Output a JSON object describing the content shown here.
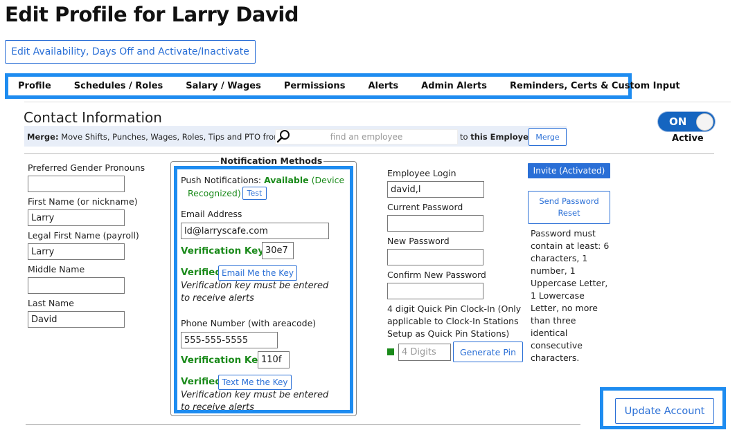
{
  "page": {
    "title": "Edit Profile for Larry David"
  },
  "availability_button": "Edit Availability, Days Off and Activate/Inactivate",
  "tabs": [
    "Profile",
    "Schedules / Roles",
    "Salary / Wages",
    "Permissions",
    "Alerts",
    "Admin Alerts",
    "Reminders, Certs & Custom Input"
  ],
  "contact": {
    "title": "Contact Information",
    "merge_bold": "Merge:",
    "merge_text": " Move Shifts, Punches, Wages, Roles, Tips and PTO from",
    "search_placeholder": "find an employee",
    "to_prefix": "to ",
    "to_bold": "this Employee",
    "merge_button": "Merge",
    "toggle_label": "ON",
    "status": "Active"
  },
  "fields": {
    "pronouns_label": "Preferred Gender Pronouns",
    "pronouns_value": "",
    "first_label": "First Name (or nickname)",
    "first_value": "Larry",
    "legal_label": "Legal First Name (payroll)",
    "legal_value": "Larry",
    "middle_label": "Middle Name",
    "middle_value": "",
    "last_label": "Last Name",
    "last_value": "David"
  },
  "notifications": {
    "legend": "Notification Methods",
    "push_label": "Push Notifications: ",
    "push_status": "Available",
    "push_detail_1": " (Device",
    "push_detail_2": "Recognized)",
    "test_button": "Test",
    "email_label": "Email Address",
    "email_value": "ld@larryscafe.com",
    "email_key_label": "Verification Key",
    "email_key_value": "30e7",
    "email_verified": "Verified",
    "email_key_button": "Email Me the Key",
    "email_note_1": "Verification key must be entered",
    "email_note_2": "to receive alerts",
    "phone_label": "Phone Number (with areacode)",
    "phone_value": "555-555-5555",
    "phone_key_label": "Verification Key",
    "phone_key_value": "110f",
    "phone_verified": "Verified",
    "phone_key_button": "Text Me the Key",
    "phone_note_1": "Verification key must be entered",
    "phone_note_2": "to receive alerts"
  },
  "login": {
    "login_label": "Employee Login",
    "login_value": "david,l",
    "current_pw_label": "Current Password",
    "new_pw_label": "New Password",
    "confirm_pw_label": "Confirm New Password",
    "pin_note_1": "4 digit Quick Pin Clock-In (Only",
    "pin_note_2": "applicable to Clock-In Stations",
    "pin_note_3": "Setup as Quick Pin Stations)",
    "pin_placeholder": "4 Digits",
    "generate_pin": "Generate Pin"
  },
  "password": {
    "invite_button": "Invite (Activated)",
    "reset_line_1": "Send Password",
    "reset_line_2": "Reset",
    "rules": [
      "Password must",
      "contain at least: 6",
      "characters, 1",
      "number, 1",
      "Uppercase Letter,",
      "1 Lowercase",
      "Letter, no more",
      "than three",
      "identical",
      "consecutive",
      "characters."
    ]
  },
  "update_button": "Update Account",
  "colors": {
    "accent": "#2a6fd6",
    "highlight": "#1e8cf0",
    "green": "#1a8a1a",
    "toggle": "#1565c0"
  }
}
